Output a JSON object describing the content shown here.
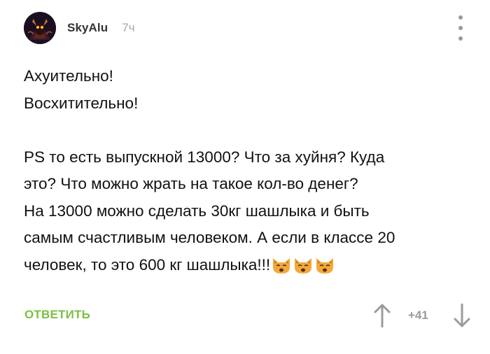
{
  "comment": {
    "author": "SkyAlu",
    "time": "7ч",
    "lines": [
      "Ахуительно!",
      "Восхитительно!",
      "",
      "PS то есть выпускной 13000? Что за хуйня? Куда",
      "это? Что можно жрать на такое кол-во денег?",
      "На 13000 можно сделать 30кг шашлыка и быть",
      "самым счастливым человеком. А если в классе 20",
      "человек, то это 600 кг шашлыка!!!"
    ],
    "trailing_emoji": [
      "weary-cat-face-icon",
      "weary-cat-face-icon",
      "weary-cat-face-icon"
    ]
  },
  "actions": {
    "reply_label": "ОТВЕТИТЬ",
    "rating": "+41",
    "upvote_icon": "arrow-up-icon",
    "downvote_icon": "arrow-down-icon"
  },
  "colors": {
    "reply": "#7bbf43",
    "muted": "#9b9b9b",
    "text": "#111111"
  }
}
